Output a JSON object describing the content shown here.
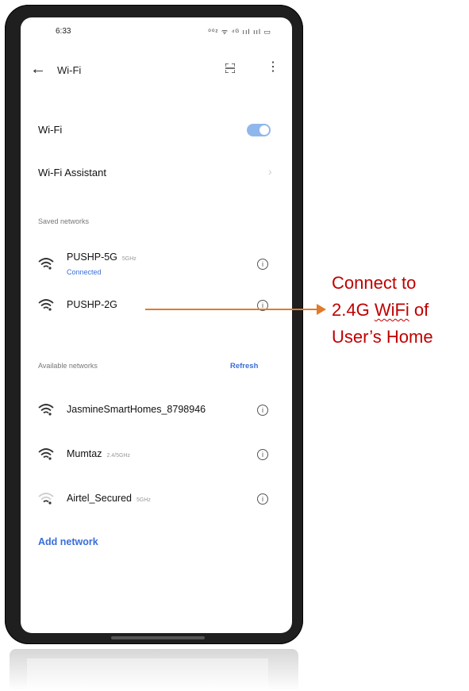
{
  "status_bar": {
    "time": "6:33",
    "icons_text": "⁰⁰² ᯤ ⁴ᴳ ııl ııl ▭"
  },
  "header": {
    "title": "Wi-Fi"
  },
  "wifi_toggle": {
    "label": "Wi-Fi",
    "state": "on"
  },
  "wifi_assistant": {
    "label": "Wi-Fi Assistant"
  },
  "saved_networks": {
    "heading": "Saved networks",
    "items": [
      {
        "name": "PUSHP-5G",
        "band": "5GHz",
        "status": "Connected"
      },
      {
        "name": "PUSHP-2G",
        "band": "",
        "status": ""
      }
    ]
  },
  "available_networks": {
    "heading": "Available networks",
    "refresh_label": "Refresh",
    "items": [
      {
        "name": "JasmineSmartHomes_8798946",
        "band": ""
      },
      {
        "name": "Mumtaz",
        "band": "2.4/5GHz"
      },
      {
        "name": "Airtel_Secured",
        "band": "5GHz"
      }
    ]
  },
  "add_network": {
    "label": "Add network"
  },
  "annotation": {
    "line1": "Connect to",
    "line2_prefix": "2.4G ",
    "line2_word": "WiFi",
    "line2_suffix": " of",
    "line3": "User’s Home"
  },
  "colors": {
    "accent": "#3a6ed8",
    "toggle": "#8fb7ec",
    "annotation_text": "#c00000",
    "arrow": "#e07b2a"
  }
}
